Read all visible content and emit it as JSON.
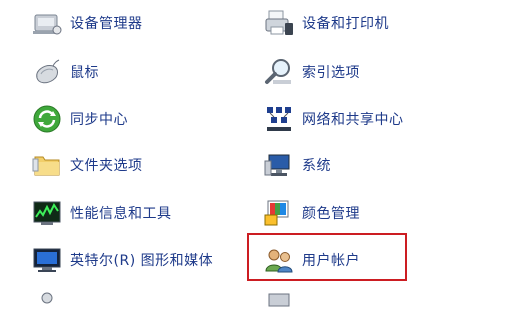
{
  "items": {
    "device_manager": "设备管理器",
    "devices_printers": "设备和打印机",
    "mouse": "鼠标",
    "indexing_options": "索引选项",
    "sync_center": "同步中心",
    "network_sharing": "网络和共享中心",
    "folder_options": "文件夹选项",
    "system": "系统",
    "performance": "性能信息和工具",
    "color_management": "颜色管理",
    "intel_graphics": "英特尔(R) 图形和媒体",
    "user_accounts": "用户帐户"
  },
  "colors": {
    "link": "#1e3a8a",
    "highlight_border": "#cc1d22"
  },
  "icons": [
    "device-manager-icon",
    "printer-icon",
    "mouse-icon",
    "magnifier-icon",
    "sync-icon",
    "network-icon",
    "folder-icon",
    "system-icon",
    "performance-icon",
    "color-management-icon",
    "intel-monitor-icon",
    "users-icon"
  ]
}
